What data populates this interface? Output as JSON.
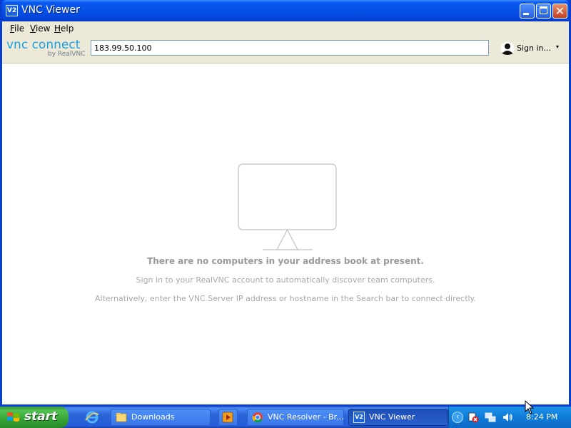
{
  "window": {
    "title": "VNC Viewer",
    "icon_text": "V2",
    "controls": {
      "close_glyph": "✕"
    }
  },
  "menu": {
    "items": [
      "File",
      "View",
      "Help"
    ]
  },
  "toolbar": {
    "logo_text": "vnc connect",
    "logo_sub": "by RealVNC",
    "search_value": "183.99.50.100",
    "signin_label": "Sign in...",
    "signin_caret": "▾"
  },
  "empty_state": {
    "heading": "There are no computers in your address book at present.",
    "line1": "Sign in to your RealVNC account to automatically discover team computers.",
    "line2": "Alternatively, enter the VNC Server IP address or hostname in the Search bar to connect directly."
  },
  "taskbar": {
    "start_label": "start",
    "tasks": [
      {
        "label": "Downloads",
        "icon": "folder-icon"
      },
      {
        "label": "",
        "icon": "media-player-icon"
      },
      {
        "label": "VNC Resolver - Br...",
        "icon": "chrome-icon"
      },
      {
        "label": "VNC Viewer",
        "icon": "vnc-icon",
        "icon_text": "V2"
      }
    ],
    "clock": "8:24 PM",
    "tray_chevron": "‹"
  },
  "colors": {
    "titlebar": "#0551e6",
    "logo_accent": "#1ba1e2",
    "empty_text": "#9a9a9a",
    "taskbar": "#245edb",
    "start_green": "#36a336"
  }
}
